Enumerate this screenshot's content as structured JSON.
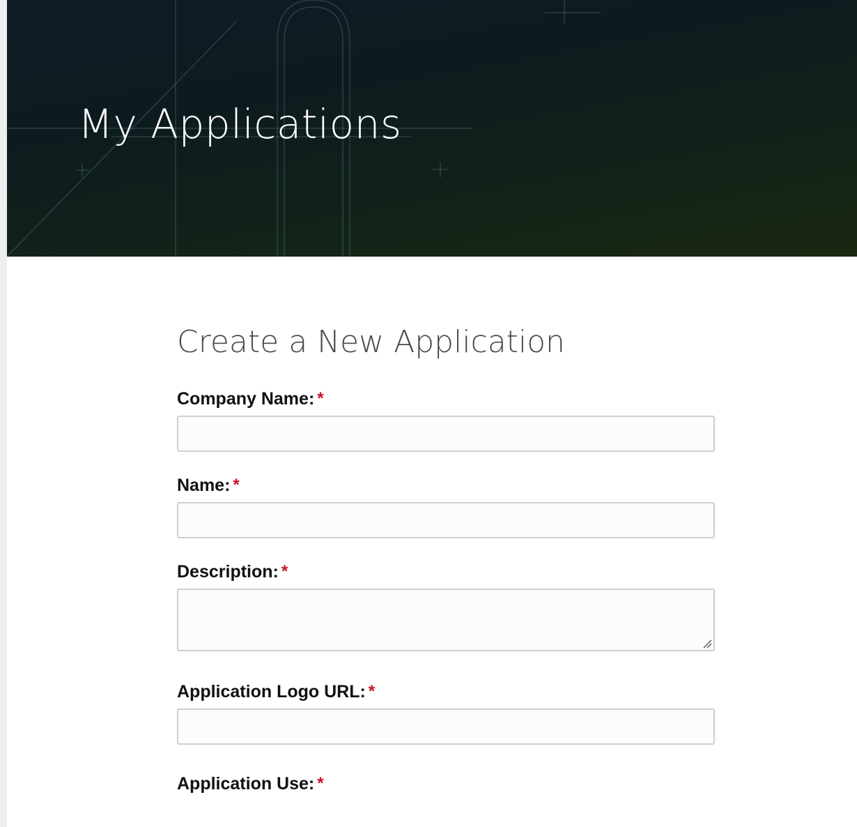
{
  "header": {
    "title": "My Applications"
  },
  "form": {
    "title": "Create a New Application",
    "required_mark": "*",
    "fields": [
      {
        "label": "Company Name:",
        "type": "text",
        "value": ""
      },
      {
        "label": "Name:",
        "type": "text",
        "value": ""
      },
      {
        "label": "Description:",
        "type": "textarea",
        "value": ""
      },
      {
        "label": "Application Logo URL:",
        "type": "text",
        "value": ""
      },
      {
        "label": "Application Use:",
        "type": "select",
        "value": ""
      }
    ]
  },
  "colors": {
    "required": "#c8102e",
    "hero_background": "#0f1b25",
    "input_border": "#cfcfcf"
  },
  "icons": {
    "textarea_resize": "resize-handle-icon"
  }
}
